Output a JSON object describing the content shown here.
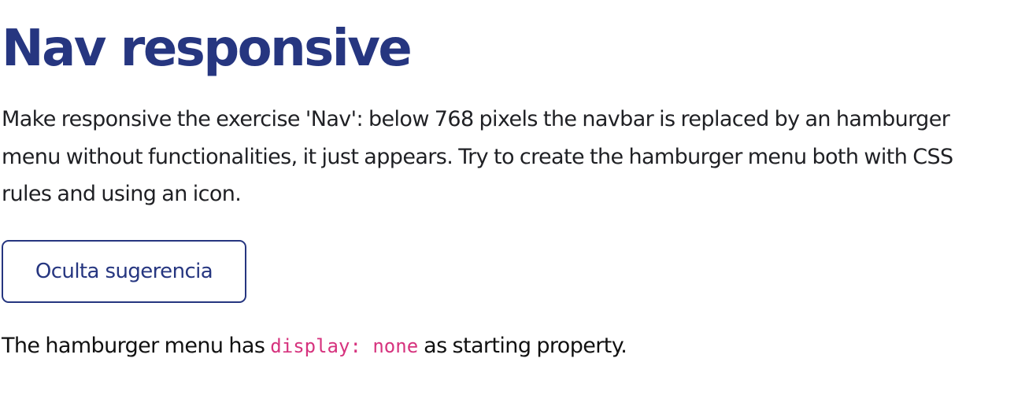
{
  "title": "Nav responsive",
  "description": "Make responsive the exercise 'Nav': below 768 pixels the navbar is replaced by an hamburger menu without functionalities, it just appears. Try to create the hamburger menu both with CSS rules and using an icon.",
  "hint_button": {
    "label": "Oculta sugerencia"
  },
  "hint": {
    "before": "The hamburger menu has ",
    "code": "display: none",
    "after": " as starting property."
  },
  "colors": {
    "title": "#263680",
    "button_border": "#263680",
    "code": "#d6337e"
  }
}
